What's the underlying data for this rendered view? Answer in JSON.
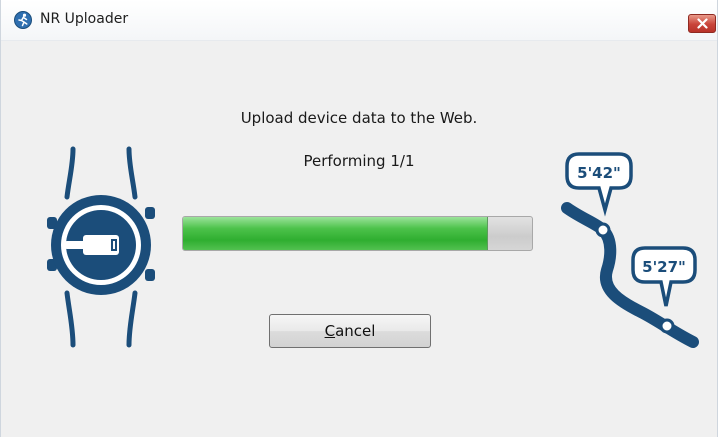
{
  "window": {
    "title": "NR Uploader",
    "close_glyph": "x"
  },
  "dialog": {
    "message": "Upload device data to the Web.",
    "status": "Performing 1/1",
    "progress": 0.87,
    "cancel_label": "Cancel",
    "cancel_mnemonic": "C"
  },
  "illustration": {
    "pace_1": "5'42\"",
    "pace_2": "5'27\""
  },
  "colors": {
    "illustration": "#1b4d7a",
    "progress": "#3fb83f",
    "close_button": "#c9443a"
  },
  "icons": {
    "app": "runner-icon",
    "close": "close-icon",
    "watch": "watch-usb-icon",
    "route": "route-map-icon"
  }
}
